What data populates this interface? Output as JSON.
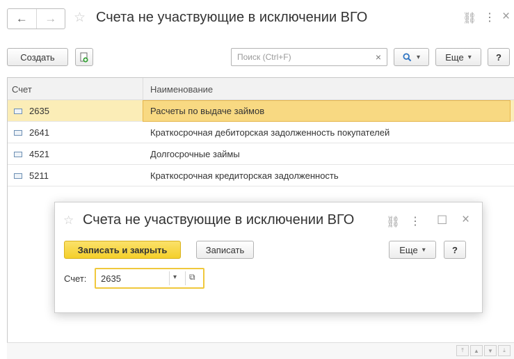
{
  "window": {
    "title": "Счета не участвующие в исключении ВГО",
    "back_icon": "←",
    "forward_icon": "→",
    "star_icon": "☆",
    "link_icon": "⛓",
    "menu_icon": "⋮",
    "close_icon": "×"
  },
  "toolbar": {
    "create_label": "Создать",
    "search_placeholder": "Поиск (Ctrl+F)",
    "clear_icon": "×",
    "search_icon": "🔍",
    "dropdown_icon": "▾",
    "more_label": "Еще",
    "help_label": "?"
  },
  "table": {
    "columns": [
      "Счет",
      "Наименование"
    ],
    "rows": [
      {
        "code": "2635",
        "name": "Расчеты по выдаче займов"
      },
      {
        "code": "2641",
        "name": "Краткосрочная дебиторская задолженность покупателей"
      },
      {
        "code": "4521",
        "name": "Долгосрочные займы"
      },
      {
        "code": "5211",
        "name": "Краткосрочная кредиторская задолженность"
      }
    ]
  },
  "dialog": {
    "title": "Счета не участвующие в исключении ВГО",
    "save_close_label": "Записать и закрыть",
    "save_label": "Записать",
    "more_label": "Еще",
    "help_label": "?",
    "field_label": "Счет:",
    "field_value": "2635",
    "star_icon": "☆",
    "link_icon": "⛓",
    "menu_icon": "⋮",
    "maximize_icon": "☐",
    "close_icon": "×",
    "dropdown_icon": "▾",
    "open_icon": "⧉"
  },
  "colors": {
    "accent_yellow": "#f4cf2a",
    "selected_row": "#fbedb7",
    "selected_cell": "#f8d982"
  }
}
